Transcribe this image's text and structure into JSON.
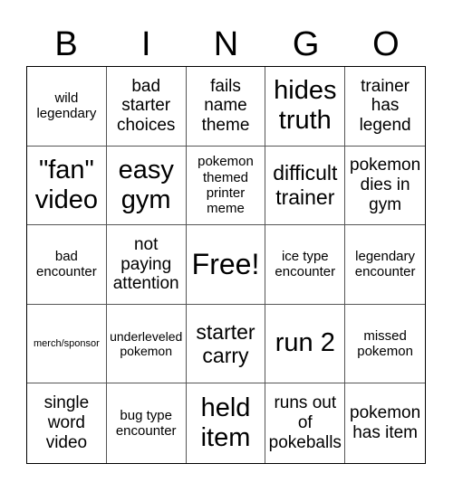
{
  "header": [
    "B",
    "I",
    "N",
    "G",
    "O"
  ],
  "cells": [
    "wild legendary",
    "bad starter choices",
    "fails name theme",
    "hides truth",
    "trainer has legend",
    "\"fan\" video",
    "easy gym",
    "pokemon themed printer meme",
    "difficult trainer",
    "pokemon dies in gym",
    "bad encounter",
    "not paying attention",
    "Free!",
    "ice type encounter",
    "legendary encounter",
    "merch/sponsor",
    "underleveled pokemon",
    "starter carry",
    "run 2",
    "missed pokemon",
    "single word video",
    "bug type encounter",
    "held item",
    "runs out of pokeballs",
    "pokemon has item"
  ]
}
